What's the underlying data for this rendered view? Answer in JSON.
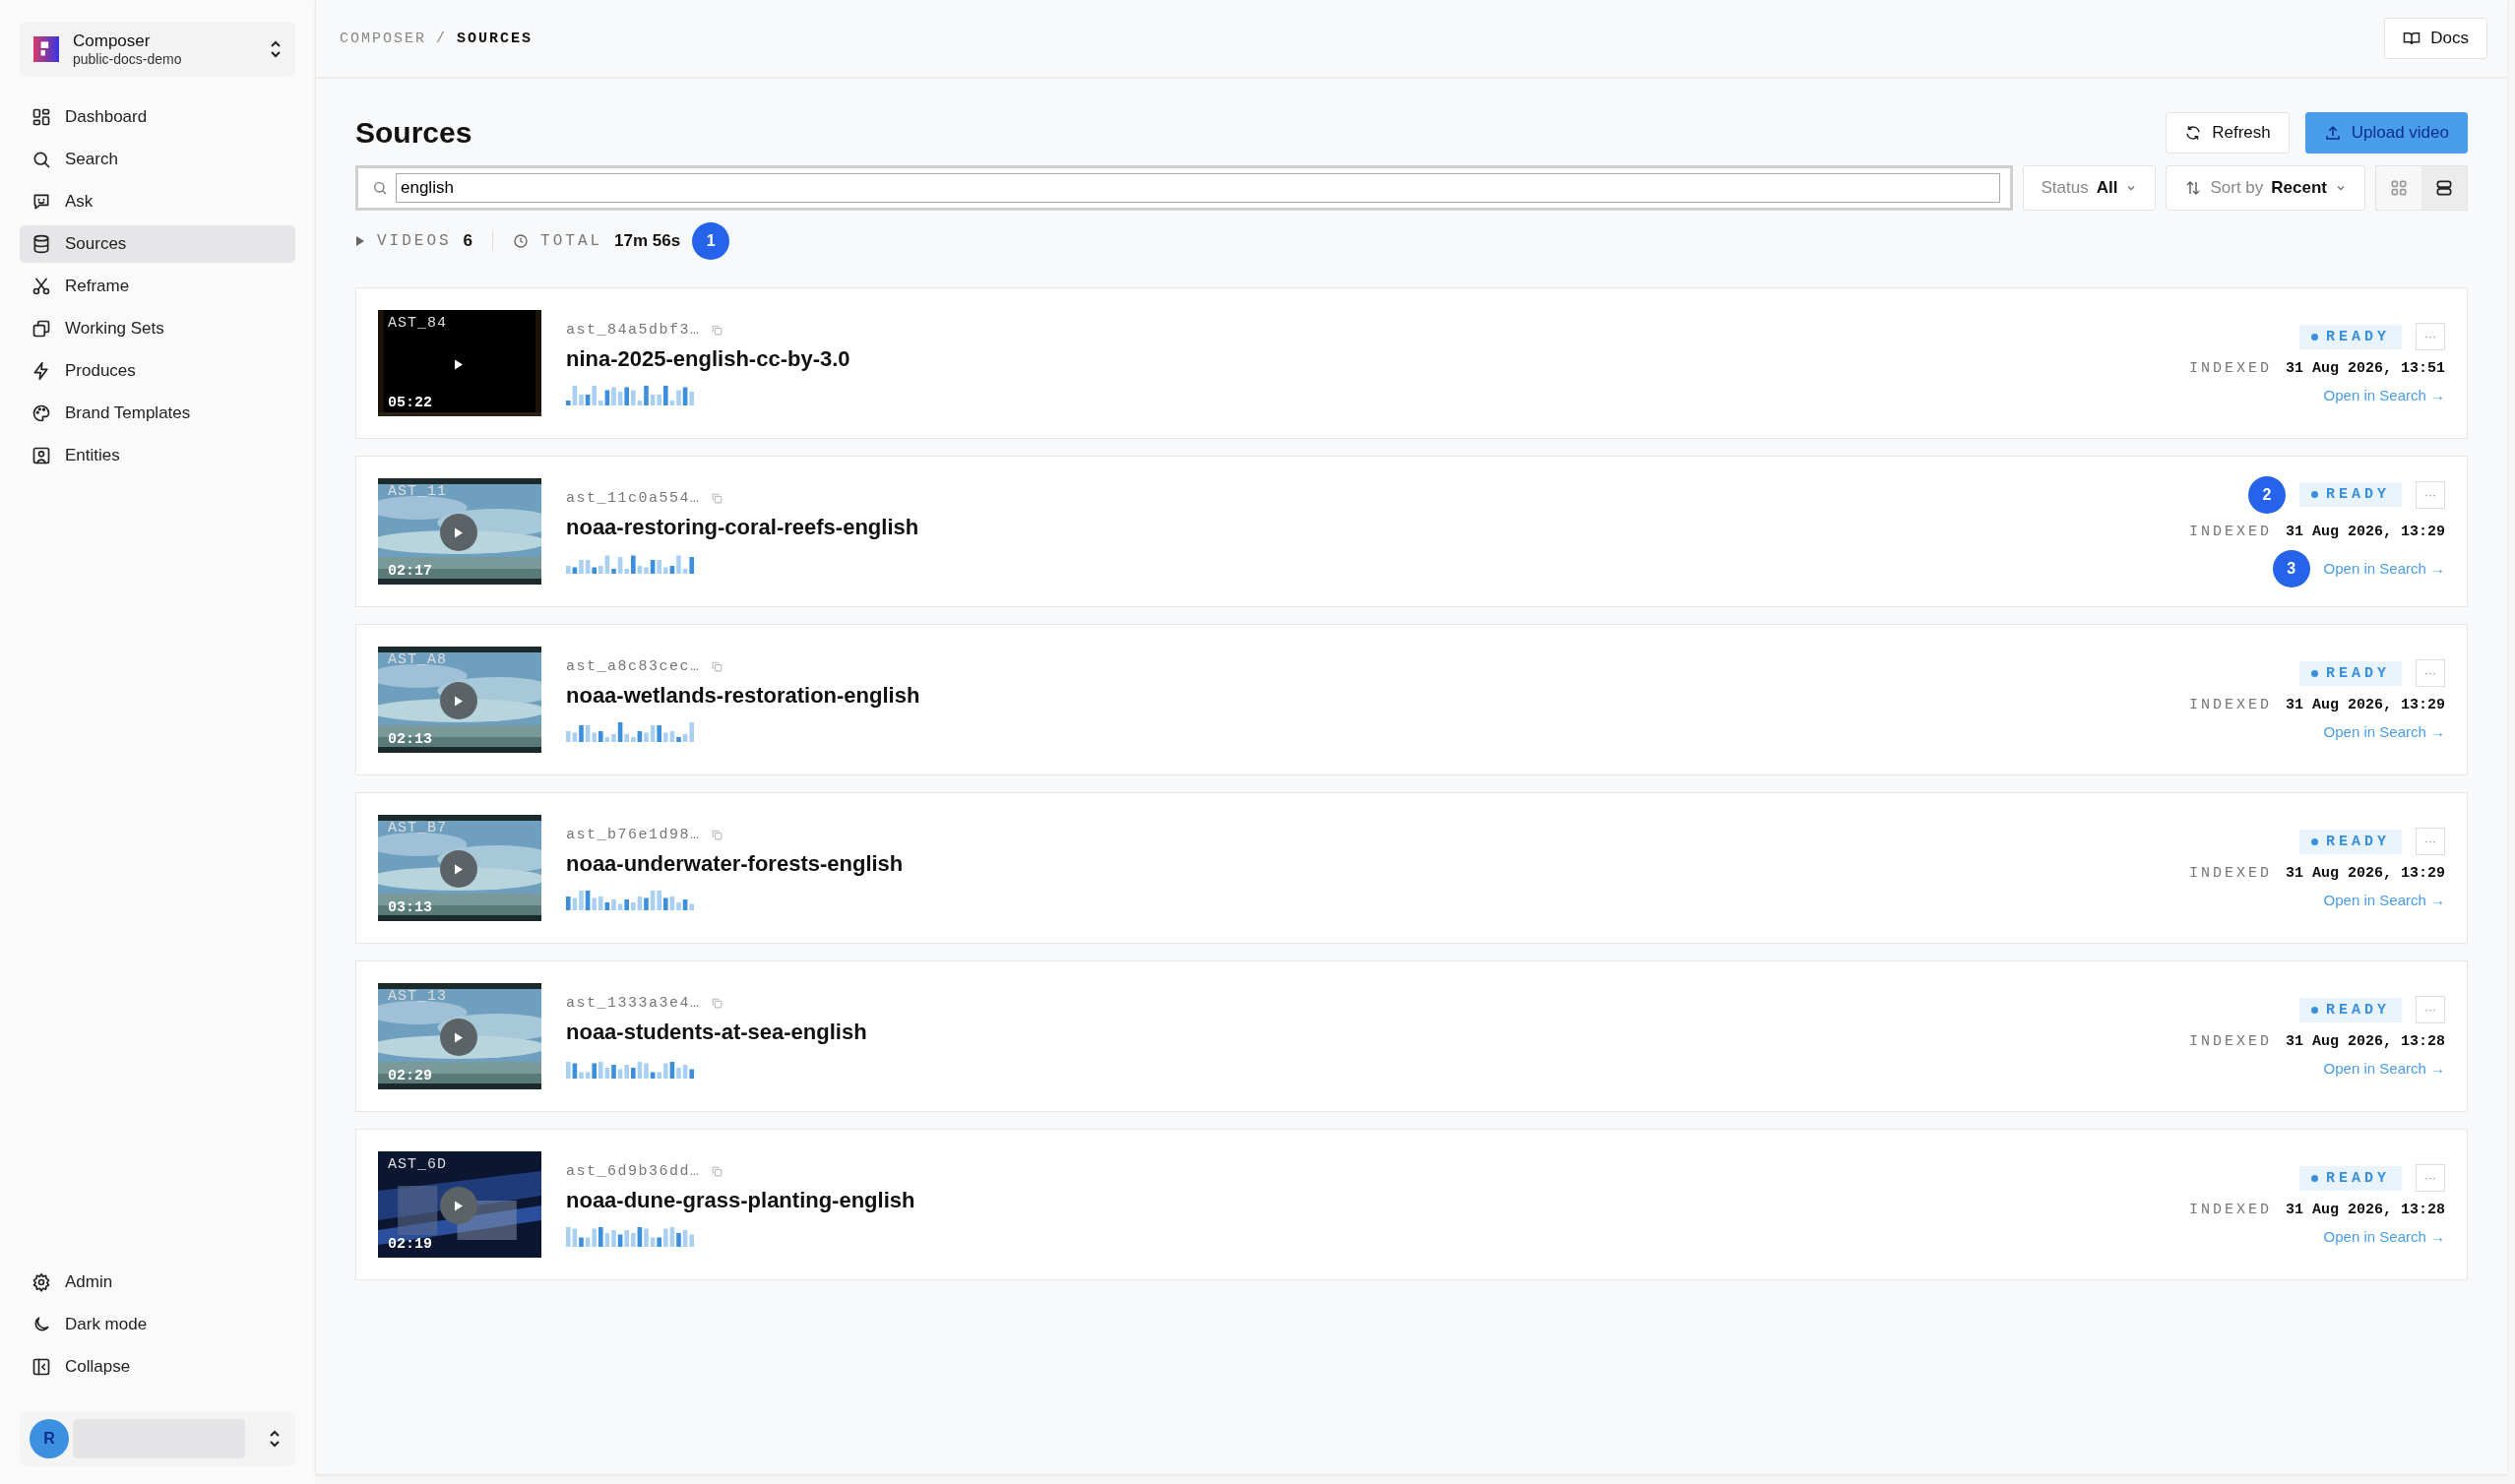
{
  "workspace": {
    "name": "Composer",
    "subtitle": "public-docs-demo"
  },
  "nav": [
    {
      "label": "Dashboard",
      "selected": false
    },
    {
      "label": "Search",
      "selected": false
    },
    {
      "label": "Ask",
      "selected": false
    },
    {
      "label": "Sources",
      "selected": true
    },
    {
      "label": "Reframe",
      "selected": false
    },
    {
      "label": "Working Sets",
      "selected": false
    },
    {
      "label": "Produces",
      "selected": false
    },
    {
      "label": "Brand Templates",
      "selected": false
    },
    {
      "label": "Entities",
      "selected": false
    }
  ],
  "nav_bottom": [
    {
      "label": "Admin"
    },
    {
      "label": "Dark mode"
    },
    {
      "label": "Collapse"
    }
  ],
  "user": {
    "initial": "R"
  },
  "breadcrumb": {
    "parent": "COMPOSER",
    "separator": "/",
    "current": "SOURCES"
  },
  "docs_button": "Docs",
  "title": "Sources",
  "refresh_button": "Refresh",
  "upload_button": "Upload video",
  "search": {
    "value": "english"
  },
  "status_filter": {
    "label": "Status",
    "value": "All"
  },
  "sort": {
    "label": "Sort by",
    "value": "Recent"
  },
  "view_modes": [
    {
      "kind": "grid",
      "selected": false
    },
    {
      "kind": "list",
      "selected": true
    }
  ],
  "summary": {
    "videos_label": "VIDEOS",
    "videos": "6",
    "total_label": "TOTAL",
    "total": "17m 56s",
    "marker": "1"
  },
  "sources": [
    {
      "code": "AST_84",
      "duration": "05:22",
      "id": "ast_84a5dbf3…",
      "name": "nina-2025-english-cc-by-3.0",
      "status": "READY",
      "menu": "···",
      "indexed_label": "INDEXED",
      "indexed": "31 Aug 2026, 13:51",
      "link": "Open in Search →"
    },
    {
      "code": "AST_11",
      "duration": "02:17",
      "id": "ast_11c0a554…",
      "name": "noaa-restoring-coral-reefs-english",
      "status": "READY",
      "menu": "···",
      "indexed_label": "INDEXED",
      "indexed": "31 Aug 2026, 13:29",
      "link": "Open in Search →",
      "badge_marker": "2",
      "link_marker": "3"
    },
    {
      "code": "AST_A8",
      "duration": "02:13",
      "id": "ast_a8c83cec…",
      "name": "noaa-wetlands-restoration-english",
      "status": "READY",
      "menu": "···",
      "indexed_label": "INDEXED",
      "indexed": "31 Aug 2026, 13:29",
      "link": "Open in Search →"
    },
    {
      "code": "AST_B7",
      "duration": "03:13",
      "id": "ast_b76e1d98…",
      "name": "noaa-underwater-forests-english",
      "status": "READY",
      "menu": "···",
      "indexed_label": "INDEXED",
      "indexed": "31 Aug 2026, 13:29",
      "link": "Open in Search →"
    },
    {
      "code": "AST_13",
      "duration": "02:29",
      "id": "ast_1333a3e4…",
      "name": "noaa-students-at-sea-english",
      "status": "READY",
      "menu": "···",
      "indexed_label": "INDEXED",
      "indexed": "31 Aug 2026, 13:28",
      "link": "Open in Search →"
    },
    {
      "code": "AST_6D",
      "duration": "02:19",
      "id": "ast_6d9b36dd…",
      "name": "noaa-dune-grass-planting-english",
      "status": "READY",
      "menu": "···",
      "indexed_label": "INDEXED",
      "indexed": "31 Aug 2026, 13:28",
      "link": "Open in Search →"
    }
  ]
}
